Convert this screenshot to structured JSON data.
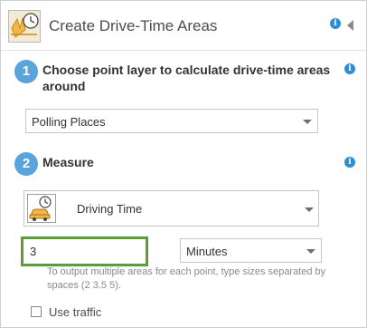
{
  "header": {
    "title": "Create Drive-Time Areas",
    "icon": "drive-time-areas-tool-icon",
    "info_icon": "i",
    "collapse_icon": "collapse-arrow-icon"
  },
  "step1": {
    "number": "1",
    "title": "Choose point layer to calculate drive-time areas around",
    "info_icon": "i",
    "layer_select": {
      "value": "Polling Places"
    }
  },
  "step2": {
    "number": "2",
    "title": "Measure",
    "info_icon": "i",
    "measure_select": {
      "value": "Driving Time",
      "icon": "car-clock-icon"
    },
    "size_input": {
      "value": "3"
    },
    "units_select": {
      "value": "Minutes"
    },
    "hint": "To output multiple areas for each point, type sizes separated by spaces (2 3.5 5).",
    "traffic": {
      "label": "Use traffic",
      "checked": false
    }
  },
  "colors": {
    "badge": "#5aa4dc",
    "info": "#2c8fd6",
    "input_highlight": "#58a033"
  }
}
